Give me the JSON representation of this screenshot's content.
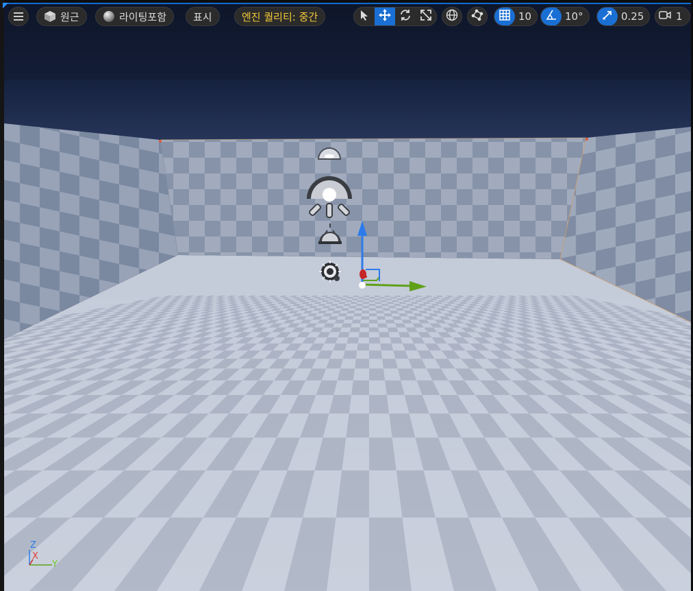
{
  "toolbar": {
    "menu_icon": "hamburger-icon",
    "perspective_label": "원근",
    "lighting_label": "라이팅포함",
    "show_label": "표시",
    "quality_label": "엔진 퀄리티: 중간",
    "transform_tools": [
      "select-arrow-icon",
      "move-icon",
      "rotate-icon",
      "scale-icon"
    ],
    "active_tool": "move-icon",
    "world_local_icon": "globe-icon",
    "surface_snap_icon": "surface-snap-icon",
    "grid_snap_value": "10",
    "rotation_snap_value": "10°",
    "scale_snap_value": "0.25",
    "camera_speed_value": "1"
  },
  "axis_indicator": {
    "z": "Z",
    "x": "X",
    "y": "Y"
  },
  "colors": {
    "accent": "#1a6fd4",
    "quality_text": "#f2c93a",
    "gizmo_x": "#c62828",
    "gizmo_y": "#5fa01a",
    "gizmo_z": "#2d7bea"
  }
}
